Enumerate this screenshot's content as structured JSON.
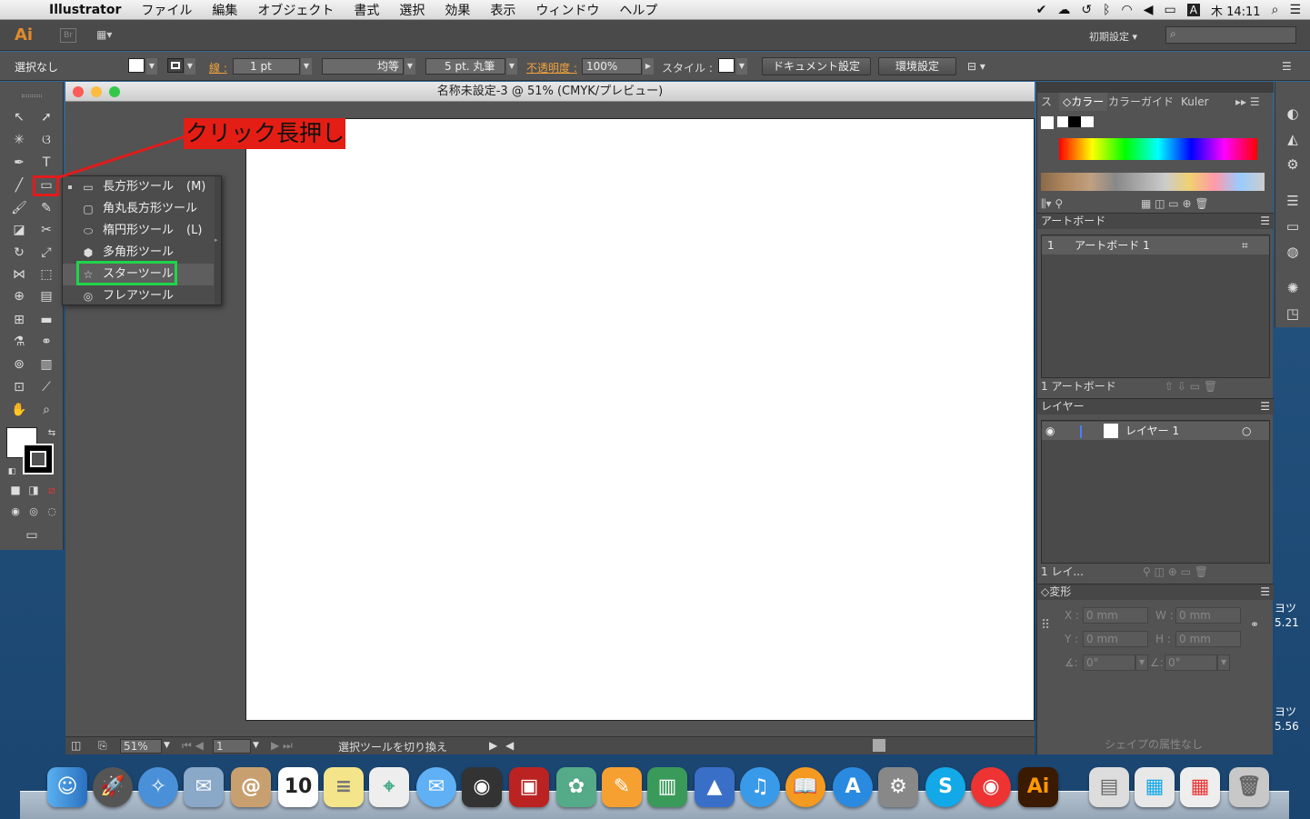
{
  "menubar": {
    "app_name": "Illustrator",
    "items": [
      "ファイル",
      "編集",
      "オブジェクト",
      "書式",
      "選択",
      "効果",
      "表示",
      "ウィンドウ",
      "ヘルプ"
    ],
    "clock": "木 14:11",
    "input_mode": "A"
  },
  "appbar": {
    "logo": "Ai",
    "bridge": "Br",
    "workspace": "初期設定",
    "search_placeholder": ""
  },
  "control": {
    "selection": "選択なし",
    "stroke_label": "線 :",
    "stroke_weight": "1 pt",
    "stroke_profile": "均等",
    "brush": "5 pt. 丸筆",
    "opacity_label": "不透明度 :",
    "opacity_value": "100%",
    "style_label": "スタイル :",
    "doc_setup_button": "ドキュメント設定",
    "prefs_button": "環境設定"
  },
  "document": {
    "title": "名称未設定-3 @ 51% (CMYK/プレビュー)",
    "zoom": "51%",
    "artboard_num": "1",
    "status_text": "選択ツールを切り換え"
  },
  "flyout": {
    "items": [
      {
        "label": "長方形ツール",
        "key": "(M)",
        "icon": "rectangle-icon"
      },
      {
        "label": "角丸長方形ツール",
        "key": "",
        "icon": "rounded-rectangle-icon"
      },
      {
        "label": "楕円形ツール",
        "key": "(L)",
        "icon": "ellipse-icon"
      },
      {
        "label": "多角形ツール",
        "key": "",
        "icon": "polygon-icon"
      },
      {
        "label": "スターツール",
        "key": "",
        "icon": "star-icon"
      },
      {
        "label": "フレアツール",
        "key": "",
        "icon": "flare-icon"
      }
    ]
  },
  "callout": "クリック長押し",
  "panels": {
    "color_tabs": [
      "ス",
      "カラー",
      "カラーガイド",
      "Kuler"
    ],
    "artboards_title": "アートボード",
    "artboard_row_num": "1",
    "artboard_row_name": "アートボード 1",
    "artboards_footer": "1 アートボード",
    "layers_title": "レイヤー",
    "layer_name": "レイヤー 1",
    "layers_footer": "1 レイ...",
    "transform_title": "変形",
    "x_label": "X :",
    "y_label": "Y :",
    "w_label": "W :",
    "h_label": "H :",
    "x_value": "0 mm",
    "y_value": "0 mm",
    "w_value": "0 mm",
    "h_value": "0 mm",
    "angle_value": "0°",
    "shear_value": "0°",
    "shape_none": "シェイプの属性なし"
  },
  "desktop_labels": [
    "ヨツ",
    "5.21",
    "ヨツ",
    "5.56"
  ],
  "colors": {
    "ui_dark": "#535353",
    "accent_orange": "#f0a23a",
    "callout_red": "#e41e14",
    "highlight_green": "#1fd44a"
  }
}
